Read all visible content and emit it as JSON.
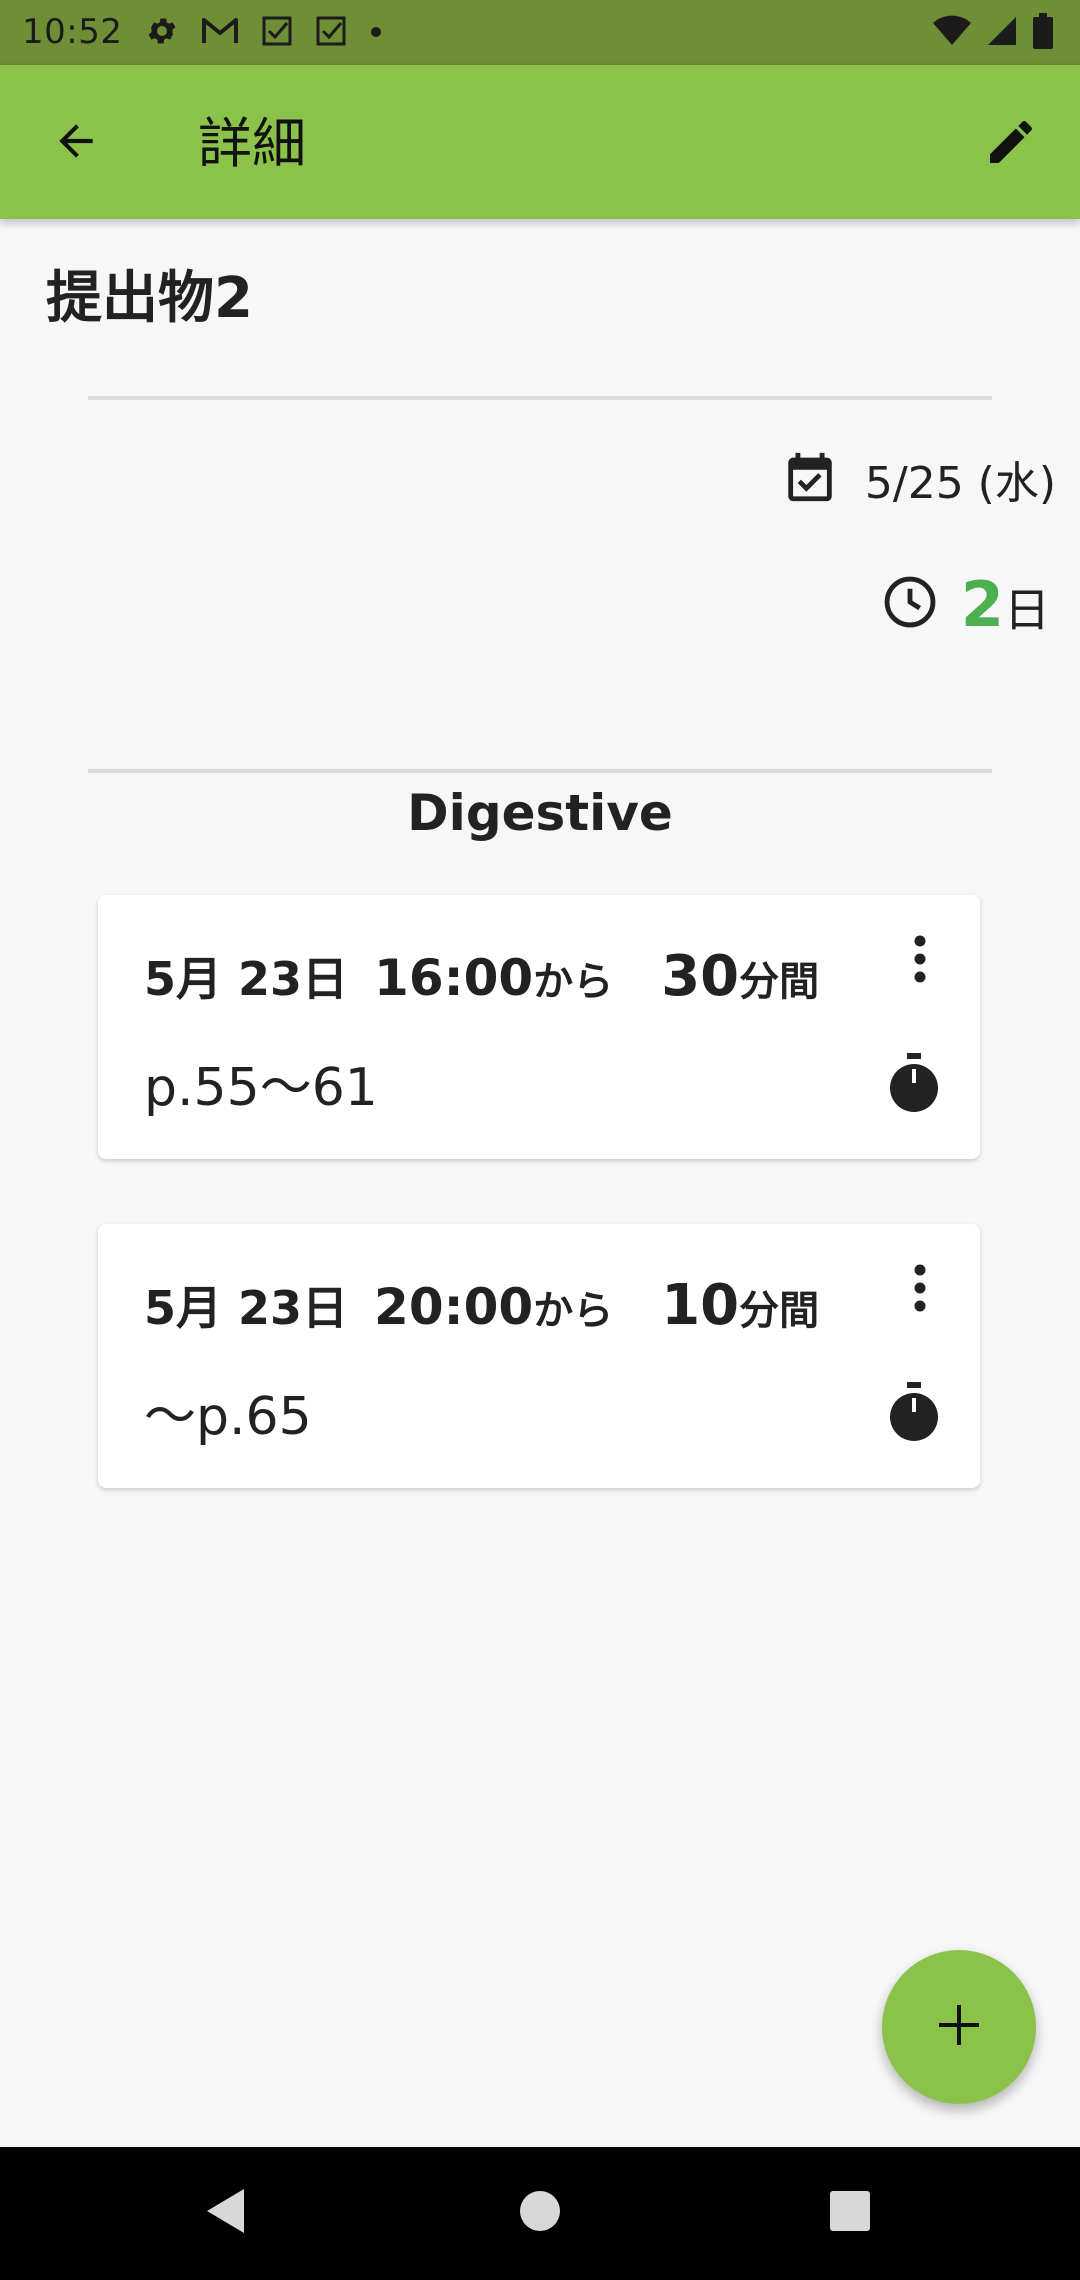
{
  "status_bar": {
    "time": "10:52",
    "icons_left": [
      "gear-icon",
      "gmail-icon",
      "checkbox-icon",
      "checkbox-icon",
      "dot-icon"
    ],
    "icons_right": [
      "wifi-icon",
      "signal-icon",
      "battery-icon"
    ]
  },
  "app_bar": {
    "title": "詳細",
    "back_icon": "arrow-back-icon",
    "edit_icon": "pencil-icon"
  },
  "task": {
    "title": "提出物2",
    "due_date": "5/25 (水)",
    "remaining_value": "2",
    "remaining_unit": "日",
    "subject": "Digestive"
  },
  "sessions": [
    {
      "date": "5月 23日",
      "time": "16:00",
      "from_label": "から",
      "duration": "30",
      "duration_unit": "分間",
      "note": "p.55〜61"
    },
    {
      "date": "5月 23日",
      "time": "20:00",
      "from_label": "から",
      "duration": "10",
      "duration_unit": "分間",
      "note": "〜p.65"
    }
  ],
  "fab": {
    "icon": "plus-icon"
  },
  "nav_bar": {
    "icons": [
      "back-triangle-icon",
      "home-circle-icon",
      "recents-square-icon"
    ]
  },
  "colors": {
    "status_bar": "#6f8f36",
    "app_bar": "#8bc34a",
    "remaining_accent": "#4caf50",
    "background": "#f7f7f7"
  }
}
